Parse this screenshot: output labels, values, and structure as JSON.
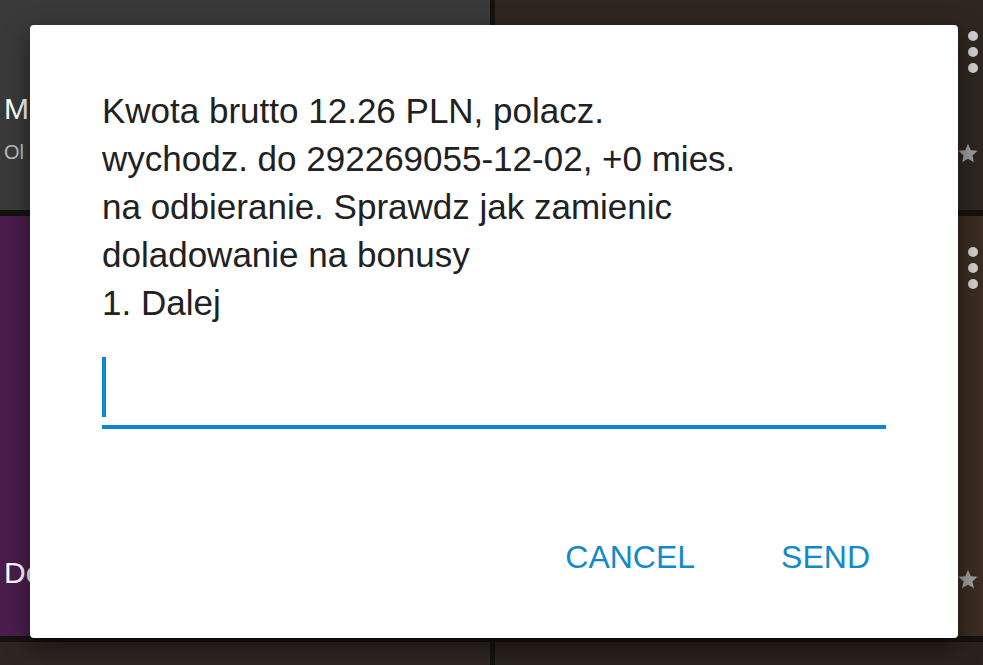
{
  "background": {
    "columns": [
      {
        "tiles": [
          {
            "title": "M",
            "subtitle": "Ol",
            "starred": false,
            "color": "#3a3a3a"
          },
          {
            "title": "Do",
            "starred": false,
            "color": "#4a1d4c"
          },
          {
            "starred": false,
            "color": "#2e2622"
          }
        ]
      },
      {
        "tiles": [
          {
            "starred": true,
            "color": "#2f2620"
          },
          {
            "starred": true,
            "color": "#3a2c22"
          },
          {
            "starred": false,
            "color": "#2b231e"
          }
        ]
      }
    ]
  },
  "dialog": {
    "message_lines": [
      "Kwota brutto 12.26 PLN, polacz.",
      "wychodz. do 292269055-12-02, +0 mies.",
      "na odbieranie. Sprawdz jak zamienic",
      "doladowanie na bonusy",
      "1. Dalej"
    ],
    "input": {
      "value": "",
      "focused": true
    },
    "buttons": [
      {
        "label": "CANCEL"
      },
      {
        "label": "SEND"
      }
    ]
  }
}
